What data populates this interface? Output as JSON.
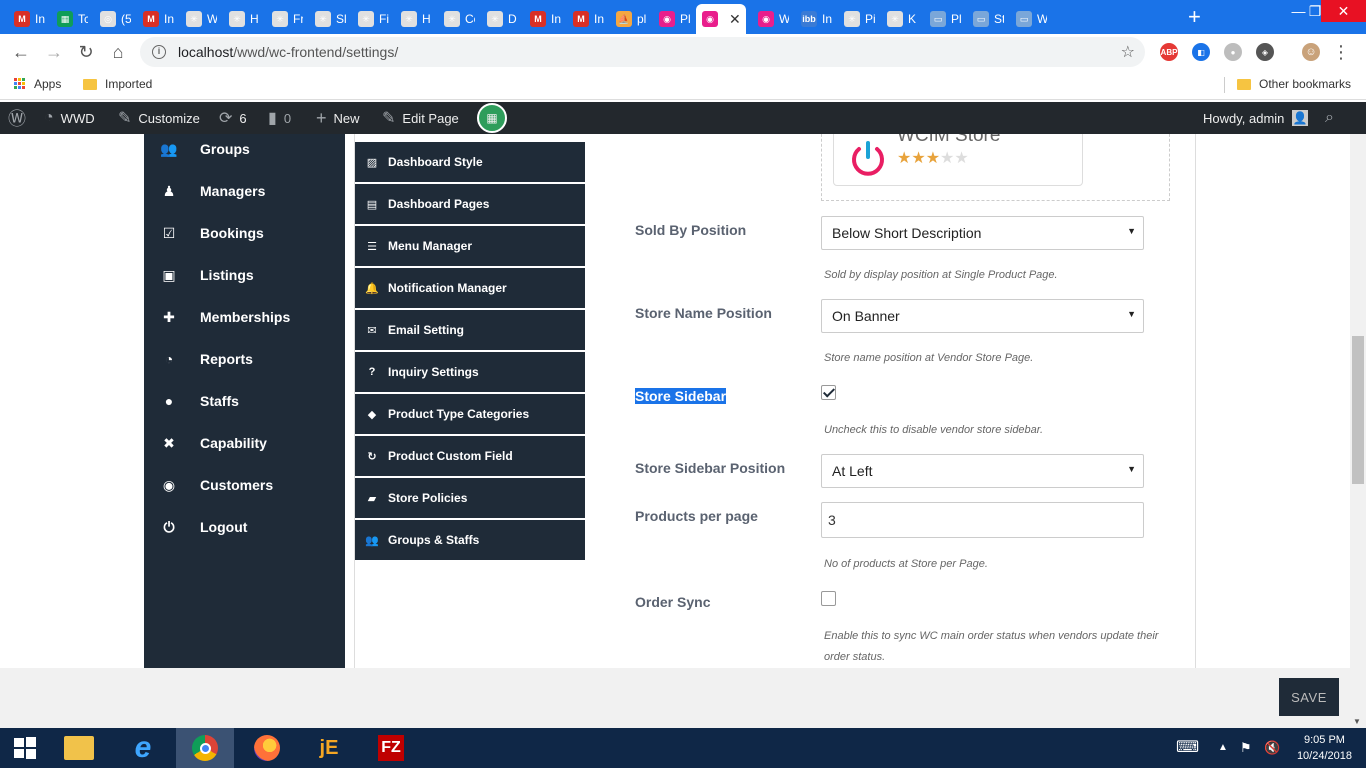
{
  "browser": {
    "tabs": [
      {
        "label": "In",
        "color": "#d93025",
        "glyph": "M"
      },
      {
        "label": "Tc",
        "color": "#0f9d58",
        "glyph": "▦"
      },
      {
        "label": "(5",
        "color": "#e0e0e0",
        "glyph": "◎"
      },
      {
        "label": "In",
        "color": "#d93025",
        "glyph": "M"
      },
      {
        "label": "W",
        "color": "#e0e0e0",
        "glyph": "✳"
      },
      {
        "label": "H",
        "color": "#e0e0e0",
        "glyph": "✳"
      },
      {
        "label": "Fr",
        "color": "#e0e0e0",
        "glyph": "✳"
      },
      {
        "label": "Sl",
        "color": "#e0e0e0",
        "glyph": "✳"
      },
      {
        "label": "Fi",
        "color": "#e0e0e0",
        "glyph": "✳"
      },
      {
        "label": "H",
        "color": "#e0e0e0",
        "glyph": "✳"
      },
      {
        "label": "Cc",
        "color": "#e0e0e0",
        "glyph": "✳"
      },
      {
        "label": "D",
        "color": "#e0e0e0",
        "glyph": "✳"
      },
      {
        "label": "In",
        "color": "#d93025",
        "glyph": "M"
      },
      {
        "label": "In",
        "color": "#d93025",
        "glyph": "M"
      },
      {
        "label": "pl",
        "color": "#f4a742",
        "glyph": "⛵"
      },
      {
        "label": "Pl",
        "color": "#e91e8c",
        "glyph": "◉"
      },
      {
        "label": "",
        "color": "#e91e8c",
        "glyph": "◉",
        "active": true
      },
      {
        "label": "W",
        "color": "#e91e8c",
        "glyph": "◉"
      },
      {
        "label": "In",
        "color": "#3a7bd5",
        "glyph": "ibb"
      },
      {
        "label": "Pi",
        "color": "#e0e0e0",
        "glyph": "✳"
      },
      {
        "label": "K",
        "color": "#e0e0e0",
        "glyph": "✳"
      },
      {
        "label": "Pl",
        "color": "#7aa7d9",
        "glyph": "▭"
      },
      {
        "label": "St",
        "color": "#7aa7d9",
        "glyph": "▭"
      },
      {
        "label": "W",
        "color": "#7aa7d9",
        "glyph": "▭"
      }
    ],
    "tab_close": "✕",
    "new_tab": "+",
    "url_host": "localhost",
    "url_path": "/wwd/wc-frontend/settings/",
    "extensions": [
      {
        "label": "ABP",
        "color": "#e53935"
      },
      {
        "label": "◧",
        "color": "#1a73e8"
      },
      {
        "label": "●",
        "color": "#bdbdbd"
      },
      {
        "label": "◈",
        "color": "#555555"
      }
    ],
    "bookmarks": {
      "apps": "Apps",
      "imported": "Imported",
      "other": "Other bookmarks"
    }
  },
  "adminbar": {
    "site": "WWD",
    "customize": "Customize",
    "updates": "6",
    "comments": "0",
    "new": "New",
    "edit_page": "Edit Page",
    "howdy": "Howdy, admin"
  },
  "sidebar": {
    "items": [
      {
        "label": "Groups",
        "icon": "users-icon",
        "glyph": "👥"
      },
      {
        "label": "Managers",
        "icon": "manager-icon",
        "glyph": "♟"
      },
      {
        "label": "Bookings",
        "icon": "calendar-check-icon",
        "glyph": "☑"
      },
      {
        "label": "Listings",
        "icon": "briefcase-icon",
        "glyph": "▣"
      },
      {
        "label": "Memberships",
        "icon": "user-plus-icon",
        "glyph": "✚"
      },
      {
        "label": "Reports",
        "icon": "pie-chart-icon",
        "glyph": "◔"
      },
      {
        "label": "Staffs",
        "icon": "user-icon",
        "glyph": "●"
      },
      {
        "label": "Capability",
        "icon": "user-times-icon",
        "glyph": "✖"
      },
      {
        "label": "Customers",
        "icon": "user-circle-icon",
        "glyph": "◉"
      },
      {
        "label": "Logout",
        "icon": "power-icon",
        "glyph": "⏻"
      }
    ]
  },
  "submenu": {
    "items": [
      {
        "label": "Dashboard Style",
        "icon": "image-icon",
        "glyph": "▨"
      },
      {
        "label": "Dashboard Pages",
        "icon": "pages-icon",
        "glyph": "▤"
      },
      {
        "label": "Menu Manager",
        "icon": "menu-icon",
        "glyph": "☰"
      },
      {
        "label": "Notification Manager",
        "icon": "bell-icon",
        "glyph": "🔔"
      },
      {
        "label": "Email Setting",
        "icon": "envelope-icon",
        "glyph": "✉"
      },
      {
        "label": "Inquiry Settings",
        "icon": "question-circle-icon",
        "glyph": "?"
      },
      {
        "label": "Product Type Categories",
        "icon": "tags-icon",
        "glyph": "◆"
      },
      {
        "label": "Product Custom Field",
        "icon": "refresh-icon",
        "glyph": "↻"
      },
      {
        "label": "Store Policies",
        "icon": "truck-icon",
        "glyph": "▰"
      },
      {
        "label": "Groups & Staffs",
        "icon": "users-icon",
        "glyph": "👥"
      }
    ]
  },
  "store_card": {
    "name": "WCfM Store",
    "rating": 3,
    "rating_max": 5,
    "logo_color": "#e91e63",
    "logo_color2": "#1ba3d6"
  },
  "settings": {
    "sold_by_position": {
      "label": "Sold By Position",
      "value": "Below Short Description",
      "hint": "Sold by display position at Single Product Page."
    },
    "store_name_position": {
      "label": "Store Name Position",
      "value": "On Banner",
      "hint": "Store name position at Vendor Store Page."
    },
    "store_sidebar": {
      "label": "Store Sidebar",
      "checked": true,
      "hint": "Uncheck this to disable vendor store sidebar."
    },
    "store_sidebar_position": {
      "label": "Store Sidebar Position",
      "value": "At Left"
    },
    "products_per_page": {
      "label": "Products per page",
      "value": "3",
      "hint": "No of products at Store per Page."
    },
    "order_sync": {
      "label": "Order Sync",
      "checked": false,
      "hint_line1": "Enable this to sync WC main order status when vendors update their",
      "hint_line2": "order status."
    }
  },
  "save_label": "SAVE",
  "taskbar": {
    "time": "9:05 PM",
    "date": "10/24/2018"
  }
}
